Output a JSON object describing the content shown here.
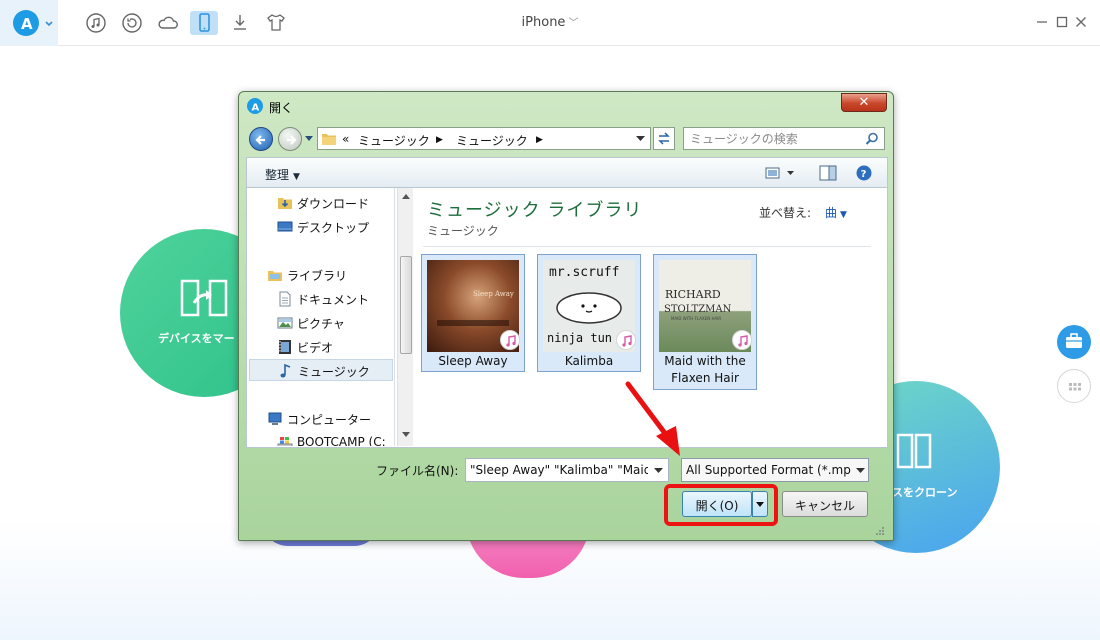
{
  "app": {
    "device_name": "iPhone",
    "toolbar_icons": [
      "music-icon",
      "restore-icon",
      "cloud-icon",
      "phone-icon",
      "download-icon",
      "shirt-icon"
    ],
    "window_controls": [
      "minimize-icon",
      "maximize-icon",
      "close-icon"
    ],
    "accent_color": "#1e9be5"
  },
  "background": {
    "left_circle_label": "デバイスをマー",
    "right_circle_label": "スをクローン"
  },
  "dialog": {
    "title": "開く",
    "address": {
      "prefix": "«",
      "crumbs": [
        "ミュージック",
        "ミュージック"
      ]
    },
    "search_placeholder": "ミュージックの検索",
    "organize_label": "整理",
    "nav_items": [
      {
        "label": "ダウンロード",
        "icon": "download-folder-icon"
      },
      {
        "label": "デスクトップ",
        "icon": "desktop-icon"
      },
      {
        "label": "ライブラリ",
        "icon": "library-icon"
      },
      {
        "label": "ドキュメント",
        "icon": "document-icon"
      },
      {
        "label": "ピクチャ",
        "icon": "picture-icon"
      },
      {
        "label": "ビデオ",
        "icon": "video-icon"
      },
      {
        "label": "ミュージック",
        "icon": "music-note-icon"
      },
      {
        "label": "コンピューター",
        "icon": "computer-icon"
      },
      {
        "label": "BOOTCAMP (C:",
        "icon": "drive-icon"
      }
    ],
    "library_title": "ミュージック ライブラリ",
    "library_subtitle": "ミュージック",
    "sort_label": "並べ替え:",
    "sort_value": "曲",
    "files": [
      {
        "caption": "Sleep Away",
        "art_text": "Sleep Away"
      },
      {
        "caption": "Kalimba",
        "art_top": "mr.scruff",
        "art_bottom": "ninja tun"
      },
      {
        "caption": "Maid with the Flaxen Hair",
        "art_line1": "RICHARD",
        "art_line2": "STOLTZMAN",
        "art_line3": "MAID WITH FLAXEN HAIR"
      }
    ],
    "filename_label": "ファイル名(N):",
    "filename_value": "\"Sleep Away\" \"Kalimba\" \"Maid",
    "filetype_value": "All Supported Format (*.mp",
    "open_label": "開く(O)",
    "cancel_label": "キャンセル",
    "highlight_color": "#ee1313"
  }
}
